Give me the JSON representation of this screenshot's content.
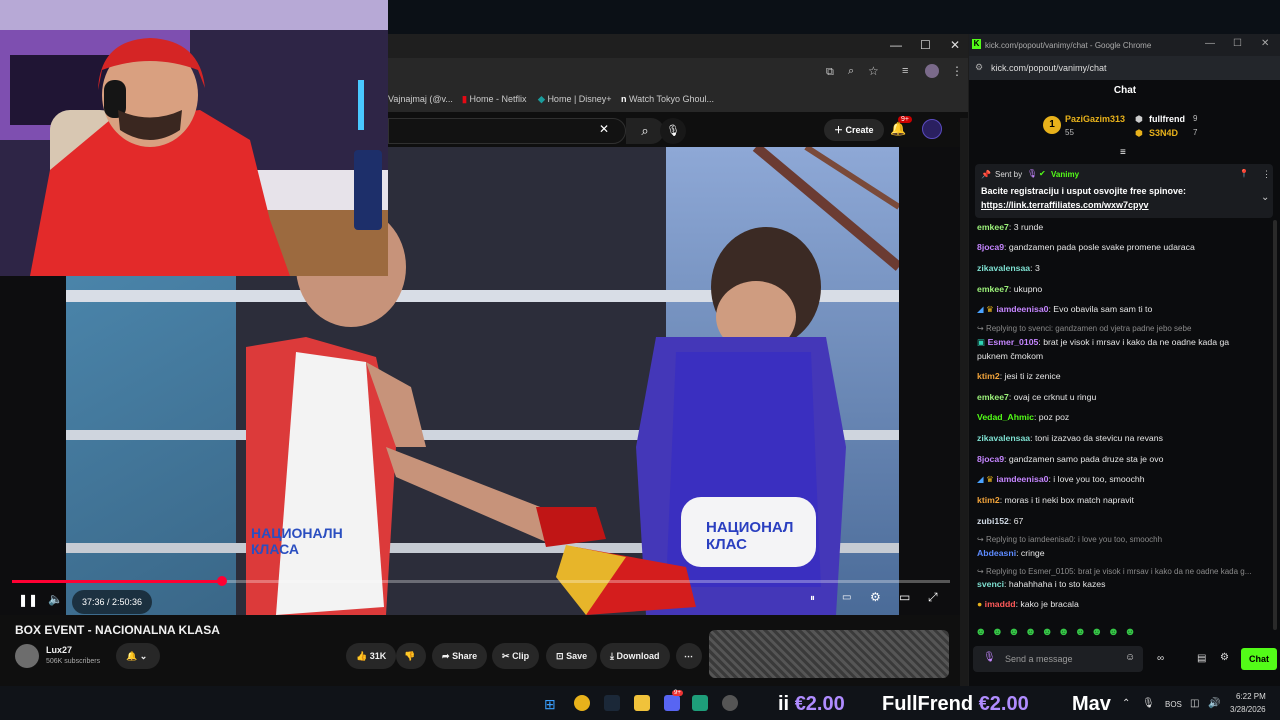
{
  "browser": {
    "bookmarks": [
      "Vajnajmaj (@v...",
      "Home - Netflix",
      "Home | Disney+",
      "Watch Tokyo Ghoul..."
    ],
    "notif_count": "9+"
  },
  "youtube": {
    "create_label": "Create",
    "time": "37:36 / 2:50:36",
    "progress": 0.224,
    "video_title": "BOX EVENT - NACIONALNA KLASA",
    "channel": "Lux27",
    "subscribers": "506K subscribers",
    "likes": "31K",
    "share": "Share",
    "clip": "Clip",
    "save": "Save",
    "download": "Download",
    "jersey_left": "НАЦИОНАЛН КЛАСА",
    "jersey_right": "НАЦИОНАЛ КЛАС"
  },
  "chat_window": {
    "title": "kick.com/popout/vanimy/chat - Google Chrome",
    "url": "kick.com/popout/vanimy/chat",
    "header": "Chat",
    "leaderboard": [
      {
        "rank": "1",
        "name": "PaziGazim313",
        "count": "55"
      },
      {
        "name": "fullfrend",
        "count": "9"
      },
      {
        "name": "S3N4D",
        "count": "7"
      }
    ],
    "pinned": {
      "sent_by": "Sent by",
      "author": "Vanimy",
      "text": "Bacite registraciju i usput osvojite free spinove:",
      "link": "https://link.terraffiliates.com/wxw7cpyv"
    },
    "messages": [
      {
        "user": "emkee7",
        "color": "#9cf27a",
        "text": ": 3 runde"
      },
      {
        "user": "8joca9",
        "color": "#c586ff",
        "text": ": gandzamen pada posle svake promene udaraca"
      },
      {
        "user": "zikavalensaa",
        "color": "#7ee0d1",
        "text": ": 3"
      },
      {
        "user": "emkee7",
        "color": "#9cf27a",
        "text": ": ukupno"
      },
      {
        "user": "iamdeenisa0",
        "color": "#c586ff",
        "text": ": Evo obavila sam sam ti to"
      },
      {
        "reply": "Replying to svenci: gandzamen od vjetra padne jebo sebe"
      },
      {
        "user": "Esmer_0105",
        "color": "#c586ff",
        "text": ": brat je visok i mrsav i kako da ne oadne kada ga"
      },
      {
        "cont": "puknem čmokom"
      },
      {
        "user": "ktim2",
        "color": "#f0a33b",
        "text": ": jesi ti iz zenice"
      },
      {
        "user": "emkee7",
        "color": "#9cf27a",
        "text": ": ovaj ce crknut u ringu"
      },
      {
        "user": "Vedad_Ahmic",
        "color": "#53fc18",
        "text": ": poz poz"
      },
      {
        "user": "zikavalensaa",
        "color": "#7ee0d1",
        "text": ": toni izazvao da stevicu na revans"
      },
      {
        "user": "8joca9",
        "color": "#c586ff",
        "text": ": gandzamen samo pada druze sta je ovo"
      },
      {
        "user": "iamdeenisa0",
        "color": "#c586ff",
        "text": ": i love you too, smoochh"
      },
      {
        "user": "ktim2",
        "color": "#f0a33b",
        "text": ": moras i ti neki box match napravit"
      },
      {
        "user": "zubi152",
        "color": "#cfd8e3",
        "text": ": 67"
      },
      {
        "reply": "Replying to iamdeenisa0: i love you too, smoochh"
      },
      {
        "user": "Abdeasni",
        "color": "#5d8bff",
        "text": ": cringe"
      },
      {
        "reply": "Replying to Esmer_0105: brat je visok i mrsav i kako da ne oadne kada g..."
      },
      {
        "user": "svenci",
        "color": "#7ee0d1",
        "text": ": hahahhaha i to sto kazes"
      },
      {
        "user": "imaddd",
        "color": "#ff5a5a",
        "text": ": kako je bracala"
      }
    ],
    "input_placeholder": "Send a message",
    "chat_button": "Chat"
  },
  "taskbar": {
    "ticker": [
      {
        "name": "ii",
        "amount": "€2.00"
      },
      {
        "name": "FullFrend",
        "amount": "€2.00"
      },
      {
        "name": "Mav",
        "amount": ""
      }
    ],
    "language": "BOS",
    "time": "6:22 PM",
    "date": "3/28/2026",
    "badge": "9+"
  }
}
